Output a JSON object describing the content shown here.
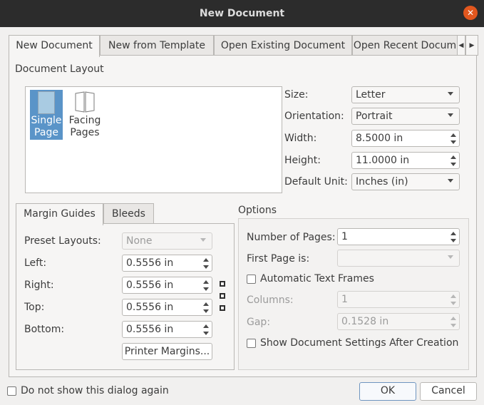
{
  "window": {
    "title": "New Document",
    "close_icon": "close-icon",
    "accent": "#e2571e"
  },
  "tabs": [
    {
      "label": "New Document"
    },
    {
      "label": "New from Template"
    },
    {
      "label": "Open Existing Document"
    },
    {
      "label": "Open Recent Docum"
    }
  ],
  "scroll_icon": "chevron-right-icon",
  "document_layout": {
    "heading": "Document Layout",
    "items": [
      {
        "label": "Single Page",
        "icon": "single-page-icon",
        "selected": true
      },
      {
        "label": "Facing Pages",
        "icon": "facing-pages-icon",
        "selected": false
      }
    ]
  },
  "page_settings": {
    "size": {
      "label": "Size:",
      "value": "Letter"
    },
    "orientation": {
      "label": "Orientation:",
      "value": "Portrait"
    },
    "width": {
      "label": "Width:",
      "value": "8.5000 in"
    },
    "height": {
      "label": "Height:",
      "value": "11.0000 in"
    },
    "default_unit": {
      "label": "Default Unit:",
      "value": "Inches (in)"
    }
  },
  "margin_tabs": [
    {
      "label": "Margin Guides"
    },
    {
      "label": "Bleeds"
    }
  ],
  "margins": {
    "preset_layouts": {
      "label": "Preset Layouts:",
      "value": "None"
    },
    "left": {
      "label": "Left:",
      "value": "0.5556 in"
    },
    "right": {
      "label": "Right:",
      "value": "0.5556 in"
    },
    "top": {
      "label": "Top:",
      "value": "0.5556 in"
    },
    "bottom": {
      "label": "Bottom:",
      "value": "0.5556 in"
    },
    "printer_margins": "Printer Margins...",
    "link_icon": "chain-link-icon"
  },
  "options": {
    "heading": "Options",
    "number_of_pages": {
      "label": "Number of Pages:",
      "value": "1"
    },
    "first_page": {
      "label": "First Page is:",
      "value": ""
    },
    "automatic_text_frames": "Automatic Text Frames",
    "columns": {
      "label": "Columns:",
      "value": "1"
    },
    "gap": {
      "label": "Gap:",
      "value": "0.1528 in"
    },
    "show_settings": "Show Document Settings After Creation"
  },
  "footer": {
    "do_not_show": "Do not show this dialog again",
    "ok": "OK",
    "cancel": "Cancel"
  },
  "colors": {
    "selection": "#5a94c8",
    "title_bar": "#2c2c2c"
  }
}
